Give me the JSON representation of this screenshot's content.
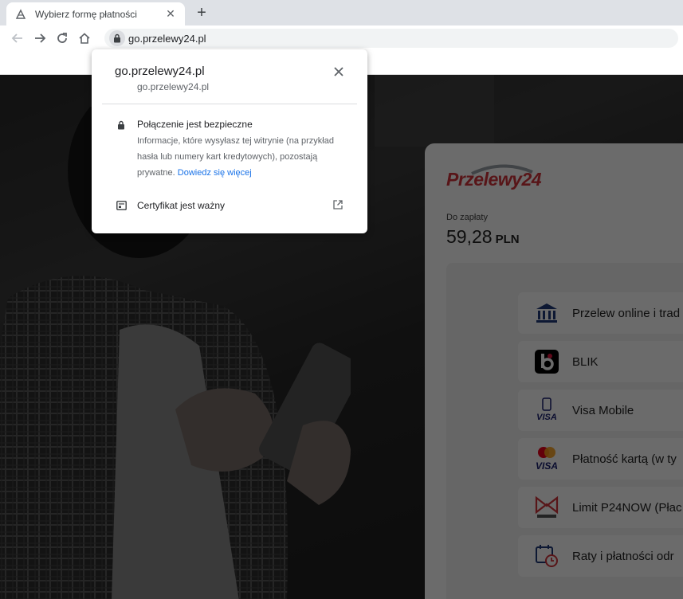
{
  "browser": {
    "tab_title": "Wybierz formę płatności",
    "url": "go.przelewy24.pl"
  },
  "popup": {
    "title": "go.przelewy24.pl",
    "subtitle": "go.przelewy24.pl",
    "secure_title": "Połączenie jest bezpieczne",
    "secure_desc": "Informacje, które wysyłasz tej witrynie (na przykład hasła lub numery kart kredytowych), pozostają prywatne.",
    "learn_more": "Dowiedz się więcej",
    "cert_label": "Certyfikat jest ważny"
  },
  "payment": {
    "brand": "Przelewy24",
    "due_label": "Do zapłaty",
    "due_amount": "59,28",
    "currency": "PLN",
    "methods": [
      {
        "label": "Przelew online i trad",
        "icon": "bank-icon"
      },
      {
        "label": "BLIK",
        "icon": "blik-icon"
      },
      {
        "label": "Visa Mobile",
        "icon": "visa-mobile-icon"
      },
      {
        "label": "Płatność kartą (w ty",
        "icon": "card-icon"
      },
      {
        "label": "Limit P24NOW (Płac",
        "icon": "p24now-icon"
      },
      {
        "label": "Raty i płatności odr",
        "icon": "installments-icon"
      }
    ]
  },
  "colors": {
    "brand_red": "#d13239",
    "link_blue": "#1a73e8",
    "chrome_bg": "#dee1e6"
  }
}
